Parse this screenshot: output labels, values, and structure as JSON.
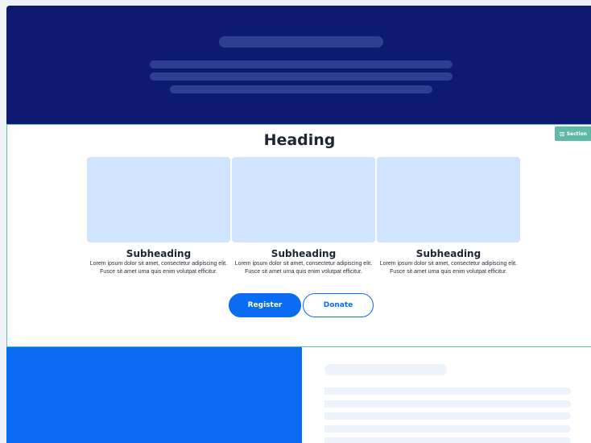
{
  "section_tag": {
    "label": "Section",
    "icon": "hamburger-icon"
  },
  "content": {
    "heading": "Heading",
    "columns": [
      {
        "subheading": "Subheading",
        "text": "Lorem ipsum dolor sit amet, consectetur adipiscing elit. Fusce sit amet urna quis enim volutpat efficitur."
      },
      {
        "subheading": "Subheading",
        "text": "Lorem ipsum dolor sit amet, consectetur adipiscing elit. Fusce sit amet urna quis enim volutpat efficitur."
      },
      {
        "subheading": "Subheading",
        "text": "Lorem ipsum dolor sit amet, consectetur adipiscing elit. Fusce sit amet urna quis enim volutpat efficitur."
      }
    ],
    "buttons": {
      "primary": "Register",
      "secondary": "Donate"
    }
  },
  "colors": {
    "hero_bg": "#0e1a70",
    "accent": "#0a6cf2",
    "image_placeholder": "#d0e3ff",
    "selection": "#5fbfae"
  }
}
